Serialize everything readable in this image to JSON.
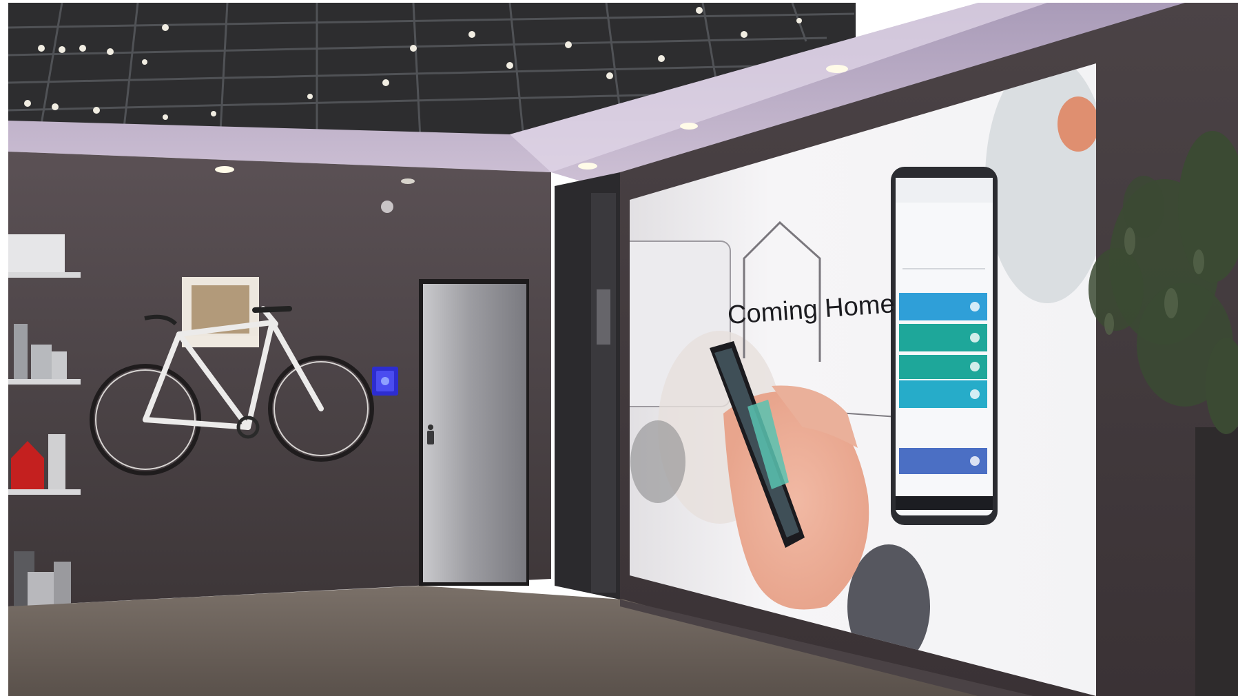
{
  "screen": {
    "caption": "Coming Home"
  },
  "palette": {
    "wall": "#4d4548",
    "ceiling_lit": "#b9a9c6",
    "floor": "#6b625b",
    "screen_white": "#f2f2f4",
    "app_blue": "#2f9fd8",
    "app_teal": "#1ea79a",
    "app_navy": "#4b6fc4",
    "door_blue_panel": "#3a3adf",
    "plant_green": "#3b4a33"
  }
}
